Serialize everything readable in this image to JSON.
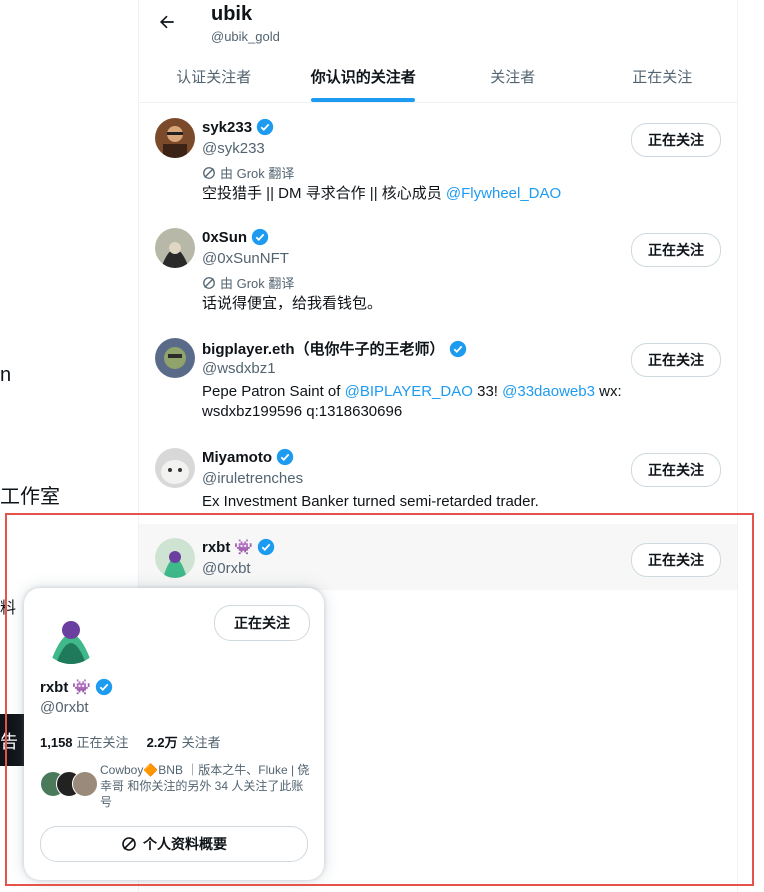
{
  "left_fragments": [
    "n",
    "工作室",
    "料",
    "告"
  ],
  "header": {
    "name": "ubik",
    "handle": "@ubik_gold"
  },
  "tabs": [
    {
      "label": "认证关注者",
      "active": false
    },
    {
      "label": "你认识的关注者",
      "active": true
    },
    {
      "label": "关注者",
      "active": false
    },
    {
      "label": "正在关注",
      "active": false
    }
  ],
  "translated_by": "由 Grok 翻译",
  "follow_label": "正在关注",
  "users": [
    {
      "name": "syk233",
      "handle": "@syk233",
      "translated": true,
      "bio_text": "空投猎手 || DM 寻求合作 || 核心成员 ",
      "bio_link": "@Flywheel_DAO"
    },
    {
      "name": "0xSun",
      "handle": "@0xSunNFT",
      "translated": true,
      "bio_text": "话说得便宜，给我看钱包。"
    },
    {
      "name": "bigplayer.eth（电你牛子的王老师）",
      "handle": "@wsdxbz1",
      "bio_p1": "Pepe Patron Saint of ",
      "bio_link1": "@BIPLAYER_DAO",
      "bio_p2": " 33! ",
      "bio_link2": "@33daoweb3",
      "bio_p3": " wx:",
      "bio_line2": "wsdxbz199596 q:1318630696"
    },
    {
      "name": "Miyamoto",
      "handle": "@iruletrenches",
      "bio_text": "Ex Investment Banker turned semi-retarded trader."
    },
    {
      "name": "rxbt",
      "emoji": "👾",
      "handle": "@0rxbt"
    }
  ],
  "hover_card": {
    "name": "rxbt",
    "emoji": "👾",
    "handle": "@0rxbt",
    "follow_label": "正在关注",
    "following_count": "1,158",
    "following_label": "正在关注",
    "followers_count": "2.2万",
    "followers_label": "关注者",
    "mutual_text": "Cowboy🔶BNB ｜版本之牛、Fluke | 侥幸哥 和你关注的另外 34 人关注了此账号",
    "profile_button": "个人资料概要"
  },
  "colors": {
    "accent": "#1d9bf0",
    "highlight": "#e5534b"
  }
}
